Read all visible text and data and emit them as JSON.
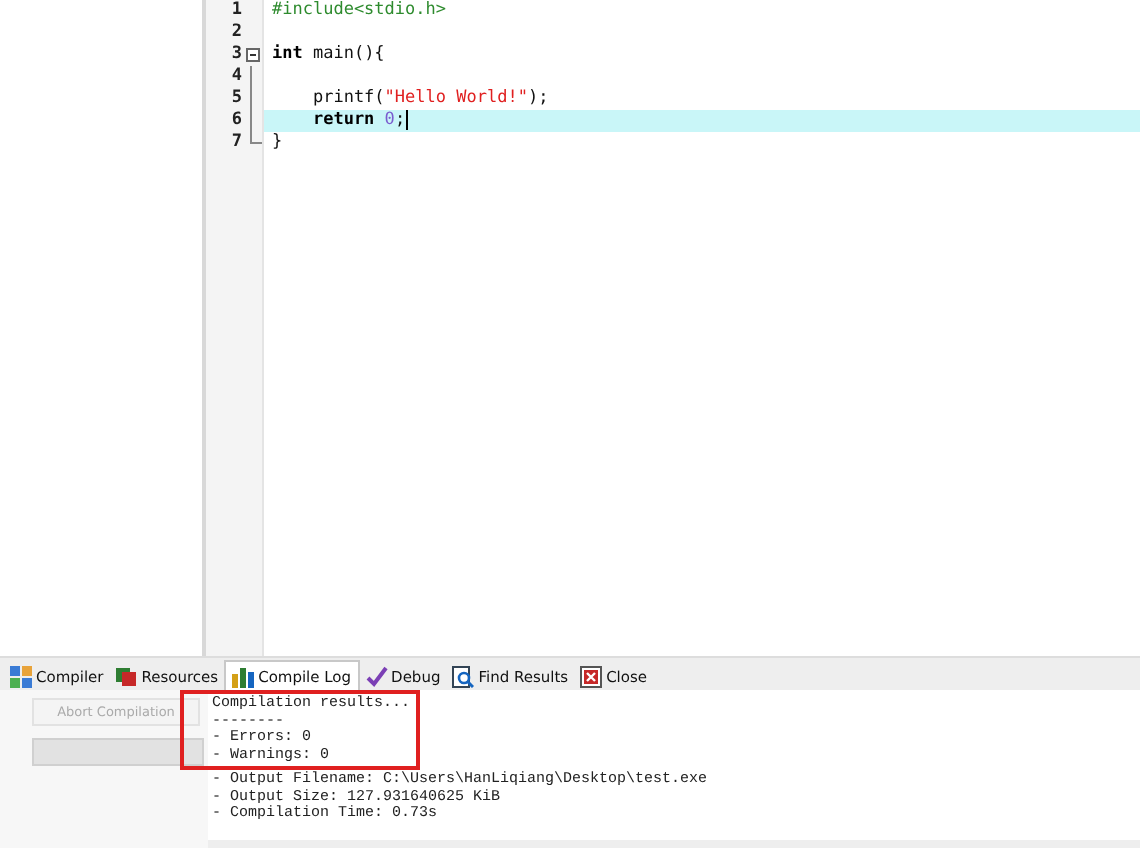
{
  "editor": {
    "lines": [
      {
        "number": "1",
        "selected": false,
        "tokens": [
          {
            "kind": "preprocessor",
            "text": "#include<stdio.h>"
          }
        ]
      },
      {
        "number": "2",
        "selected": false
      },
      {
        "number": "3",
        "selected": false,
        "expanded": true,
        "tokens": [
          {
            "kind": "keyword",
            "text": "int"
          },
          {
            "kind": "plain",
            "text": " main(){"
          }
        ]
      },
      {
        "number": "4",
        "selected": false
      },
      {
        "number": "5",
        "selected": false,
        "tokens": [
          {
            "kind": "plain",
            "text": "    printf("
          },
          {
            "kind": "string",
            "text": "\"Hello World!\""
          },
          {
            "kind": "plain",
            "text": ");"
          }
        ]
      },
      {
        "number": "6",
        "selected": true,
        "tokens": [
          {
            "kind": "keyword",
            "text": "    return"
          },
          {
            "kind": "number",
            "text": " 0"
          },
          {
            "kind": "plain",
            "text": ";"
          }
        ]
      },
      {
        "number": "7",
        "selected": false,
        "tokens": [
          {
            "kind": "plain",
            "text": "}"
          }
        ]
      }
    ]
  },
  "tabs": [
    {
      "label": "Compiler",
      "selected": false
    },
    {
      "label": "Resources",
      "selected": false
    },
    {
      "label": "Compile Log",
      "selected": true
    },
    {
      "label": "Debug",
      "selected": false
    },
    {
      "label": "Find Results",
      "selected": false
    },
    {
      "label": "Close",
      "selected": false
    }
  ],
  "abort_button": {
    "label": "Abort Compilation",
    "disabled": true
  },
  "progress": {
    "level": 0
  },
  "log": [
    "Compilation results...",
    "--------",
    "- Errors: 0",
    "- Warnings: 0",
    "- Output Filename: C:\\Users\\HanLiqiang\\Desktop\\test.exe",
    "- Output Size: 127.931640625 KiB",
    "- Compilation Time: 0.73s"
  ]
}
